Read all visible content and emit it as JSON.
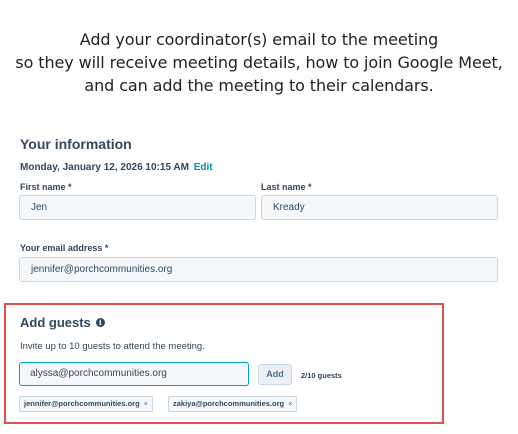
{
  "caption": {
    "line1": "Add your coordinator(s) email to the meeting",
    "line2": "so they will receive meeting details, how to join Google Meet,",
    "line3": "and can add the meeting to their calendars."
  },
  "your_information": {
    "title": "Your information",
    "datetime": "Monday, January 12, 2026 10:15 AM",
    "edit_label": "Edit",
    "first_name_label": "First name *",
    "first_name_value": "Jen",
    "last_name_label": "Last name *",
    "last_name_value": "Kready",
    "email_label": "Your email address *",
    "email_value": "jennifer@porchcommunities.org"
  },
  "add_guests": {
    "title": "Add guests",
    "info_icon": "info-icon",
    "invite_text": "Invite up to 10 guests to attend the meeting.",
    "input_value": "alyssa@porchcommunities.org",
    "add_button_label": "Add",
    "guest_count": "2/10 guests",
    "guests": [
      {
        "email": "jennifer@porchcommunities.org",
        "remove": "×"
      },
      {
        "email": "zakiya@porchcommunities.org",
        "remove": "×"
      }
    ],
    "highlight_color": "#d9534f",
    "focus_color": "#00a4bd"
  }
}
